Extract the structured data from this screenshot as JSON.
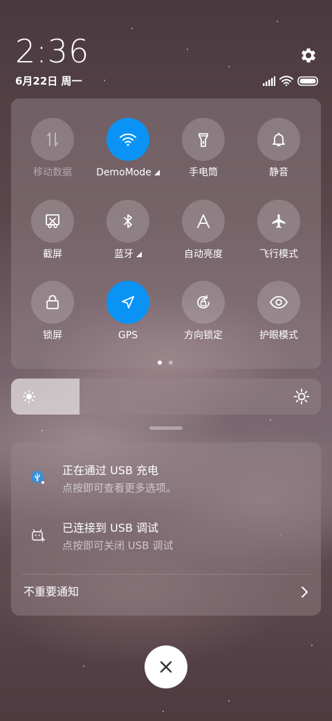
{
  "status": {
    "time": "2:36",
    "date": "6月22日 周一",
    "icons": [
      "signal-icon",
      "wifi-icon",
      "battery-icon"
    ]
  },
  "quick_settings": {
    "tiles": [
      {
        "label": "移动数据",
        "icon": "mobile-data-icon",
        "active": false,
        "dimmed": true
      },
      {
        "label": "DemoMode",
        "icon": "wifi-icon",
        "active": true,
        "expandable": true
      },
      {
        "label": "手电筒",
        "icon": "flashlight-icon",
        "active": false
      },
      {
        "label": "静音",
        "icon": "bell-icon",
        "active": false
      },
      {
        "label": "截屏",
        "icon": "screenshot-icon",
        "active": false
      },
      {
        "label": "蓝牙",
        "icon": "bluetooth-icon",
        "active": false,
        "expandable": true
      },
      {
        "label": "自动亮度",
        "icon": "auto-brightness-icon",
        "active": false
      },
      {
        "label": "飞行模式",
        "icon": "airplane-icon",
        "active": false
      },
      {
        "label": "锁屏",
        "icon": "lock-icon",
        "active": false
      },
      {
        "label": "GPS",
        "icon": "location-arrow-icon",
        "active": true
      },
      {
        "label": "方向锁定",
        "icon": "rotation-lock-icon",
        "active": false
      },
      {
        "label": "护眼模式",
        "icon": "eye-icon",
        "active": false
      }
    ],
    "page_count": 2,
    "current_page": 1
  },
  "brightness": {
    "level": 0.22
  },
  "notifications": [
    {
      "title": "正在通过 USB 充电",
      "text": "点按即可查看更多选项。",
      "icon": "usb-icon"
    },
    {
      "title": "已连接到 USB 调试",
      "text": "点按即可关闭 USB 调试",
      "icon": "android-debug-icon"
    }
  ],
  "unimportant_label": "不重要通知",
  "colors": {
    "accent": "#0a93f5",
    "panel": "#96878c"
  }
}
